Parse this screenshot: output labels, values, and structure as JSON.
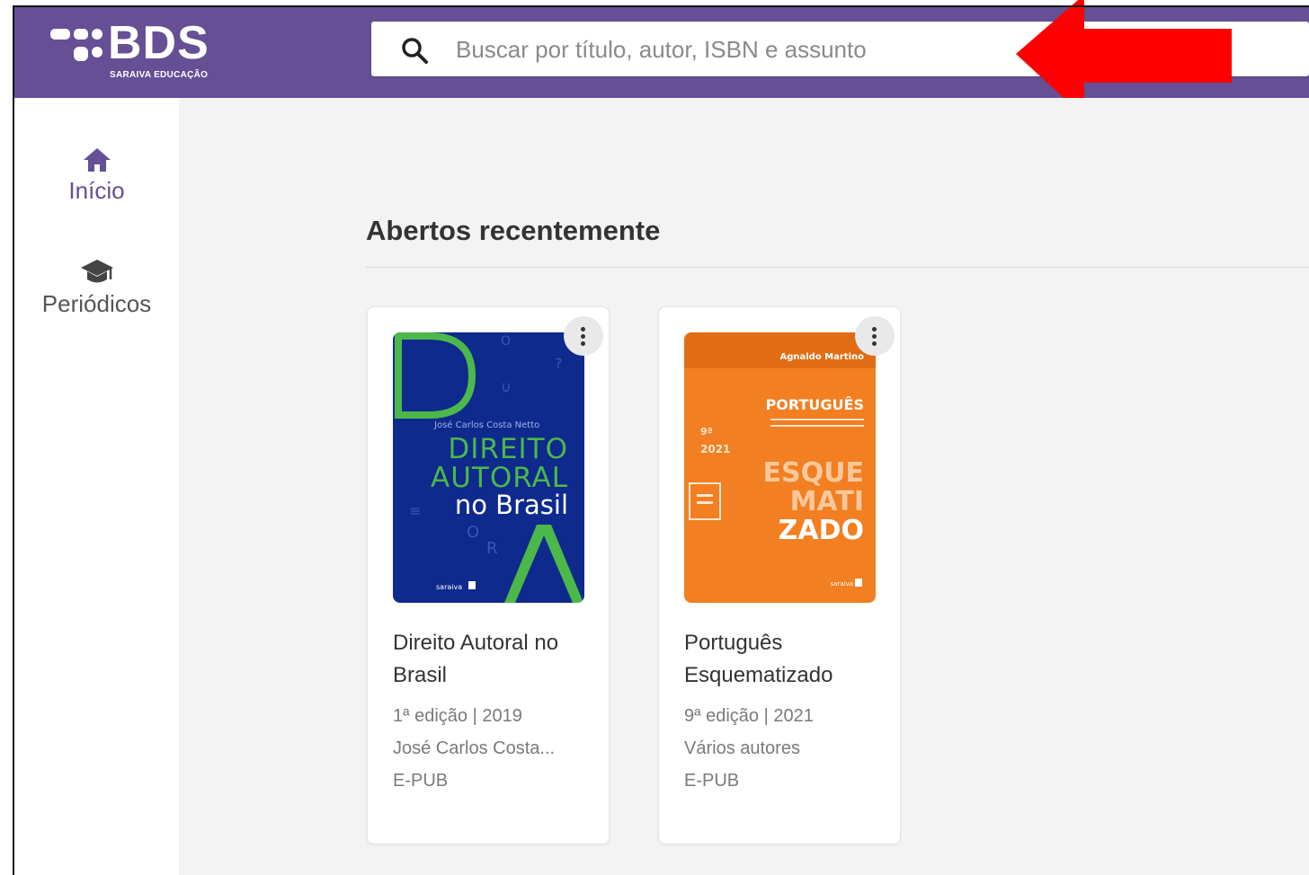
{
  "brand": {
    "name": "BDS",
    "subtitle": "SARAIVA EDUCAÇÃO"
  },
  "search": {
    "placeholder": "Buscar por título, autor, ISBN e assunto",
    "icon": "search-icon"
  },
  "sidebar": {
    "items": [
      {
        "label": "Início",
        "icon": "home-icon",
        "active": true
      },
      {
        "label": "Periódicos",
        "icon": "graduation-cap-icon",
        "active": false
      }
    ]
  },
  "main": {
    "section_title": "Abertos recentemente",
    "books": [
      {
        "title": "Direito Autoral no Brasil",
        "edition": "1ª edição | 2019",
        "author": "José Carlos Costa...",
        "format": "E-PUB",
        "cover": {
          "author": "José Carlos Costa Netto",
          "line1": "DIREITO",
          "line2": "AUTORAL",
          "line3": "no Brasil",
          "publisher": "saraiva",
          "bg": "#0e2a8c",
          "accent": "#4cb84a"
        }
      },
      {
        "title": "Português Esquematizado",
        "edition": "9ª edição | 2021",
        "author": "Vários autores",
        "format": "E-PUB",
        "cover": {
          "author": "Agnaldo Martino",
          "subject": "PORTUGUÊS",
          "edition": "9ª",
          "year": "2021",
          "line1": "ESQUE",
          "line2": "MATI",
          "line3": "ZADO",
          "publisher": "saraiva",
          "bg": "#f27f21"
        }
      }
    ]
  },
  "colors": {
    "brand_purple": "#654f95",
    "annotation_red": "#ff0000"
  }
}
